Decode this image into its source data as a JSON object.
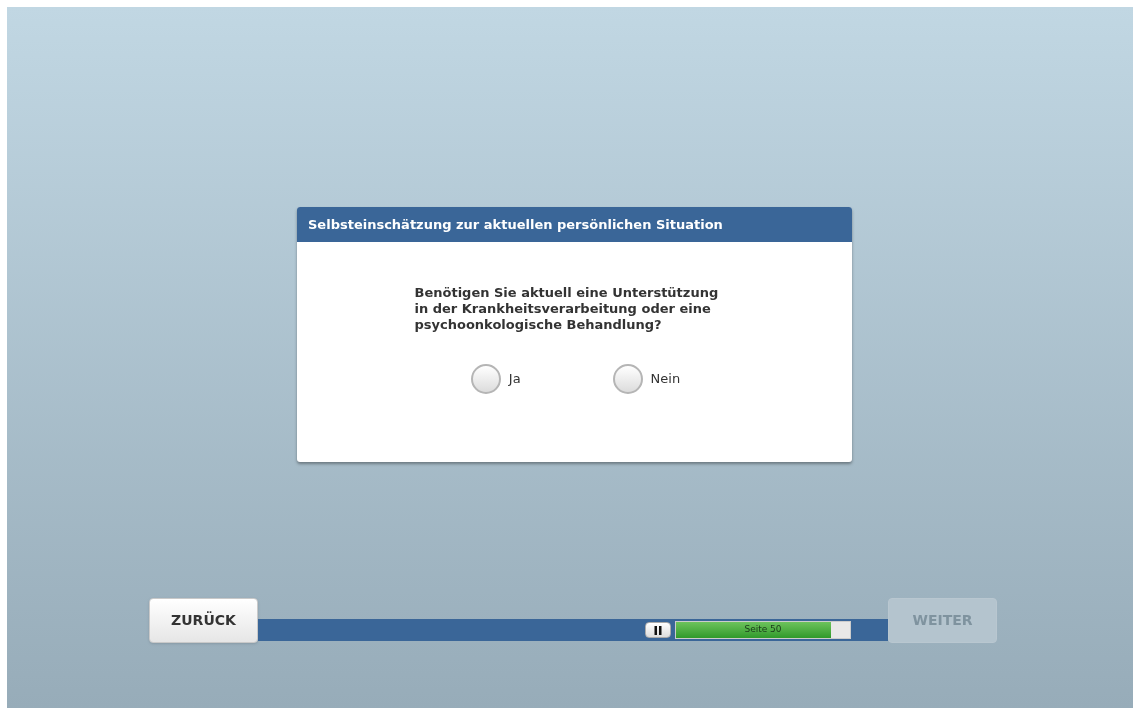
{
  "dialog": {
    "title": "Selbsteinschätzung zur aktuellen persönlichen Situation",
    "question": "Benötigen Sie aktuell eine Unterstützung\nin der Krankheitsverarbeitung oder eine\npsychoonkologische Behandlung?",
    "options": [
      {
        "label": "Ja",
        "selected": false
      },
      {
        "label": "Nein",
        "selected": false
      }
    ]
  },
  "navigation": {
    "back": {
      "label": "ZURÜCK",
      "disabled": false
    },
    "next": {
      "label": "WEITER",
      "disabled": true
    },
    "progress": {
      "label": "Seite 50",
      "level": 0.89
    }
  }
}
